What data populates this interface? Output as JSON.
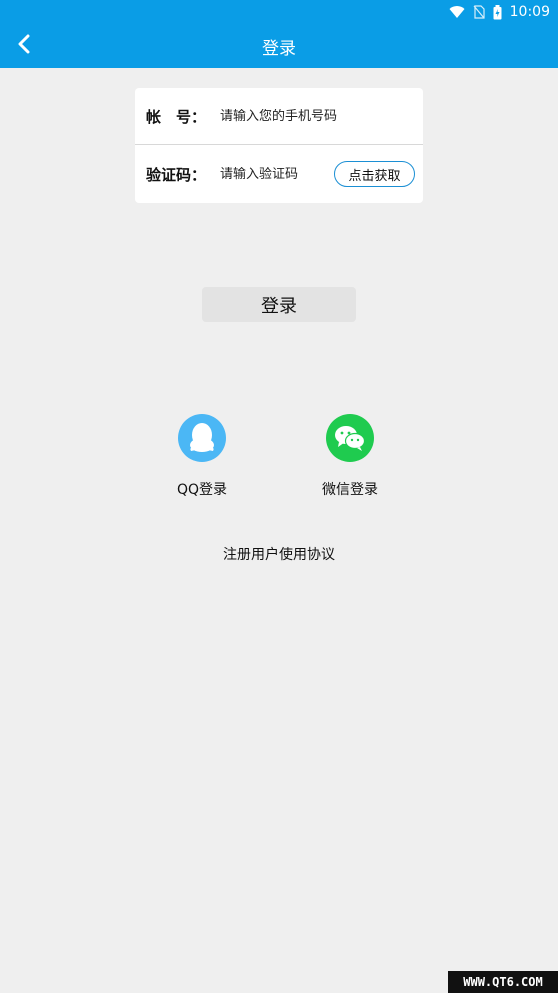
{
  "status_bar": {
    "time": "10:09"
  },
  "app_bar": {
    "title": "登录"
  },
  "form": {
    "account_label": "帐　号：",
    "account_placeholder": "请输入您的手机号码",
    "code_label": "验证码：",
    "code_placeholder": "请输入验证码",
    "get_code_label": "点击获取"
  },
  "login_button": "登录",
  "social": {
    "qq_label": "QQ登录",
    "wechat_label": "微信登录"
  },
  "agreement": "注册用户使用协议",
  "watermark": "WWW.QT6.COM",
  "colors": {
    "accent": "#0a9de6",
    "qq": "#4bb7f5",
    "wechat": "#1fcb4f"
  }
}
